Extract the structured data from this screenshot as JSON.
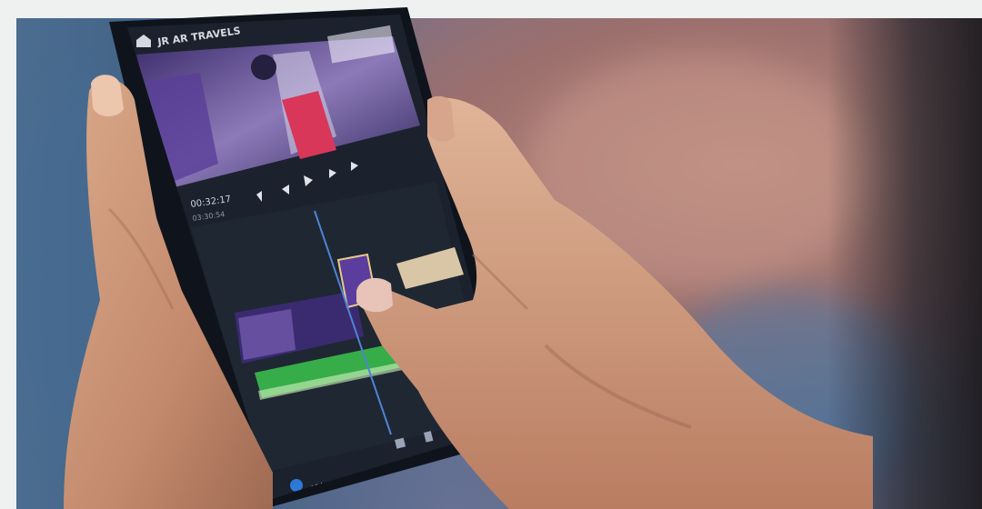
{
  "app": {
    "project_title": "JR AR TRAVELS",
    "timecode": "00:32:17",
    "timecode_sub": "03:30:54",
    "bottom_label": "Video"
  },
  "colors": {
    "phone_body": "#141a24",
    "timeline_bg": "#1e2632",
    "playhead": "#4e84d6",
    "audio_track": "#37b04a",
    "video_clip_purple": "#4a2f86",
    "accent_blue": "#2e78d8"
  },
  "icons": [
    "home-icon",
    "skip-start-icon",
    "step-back-icon",
    "play-icon",
    "step-forward-icon",
    "skip-end-icon",
    "add-clip-icon",
    "copy-icon",
    "delete-icon",
    "media-icon"
  ]
}
